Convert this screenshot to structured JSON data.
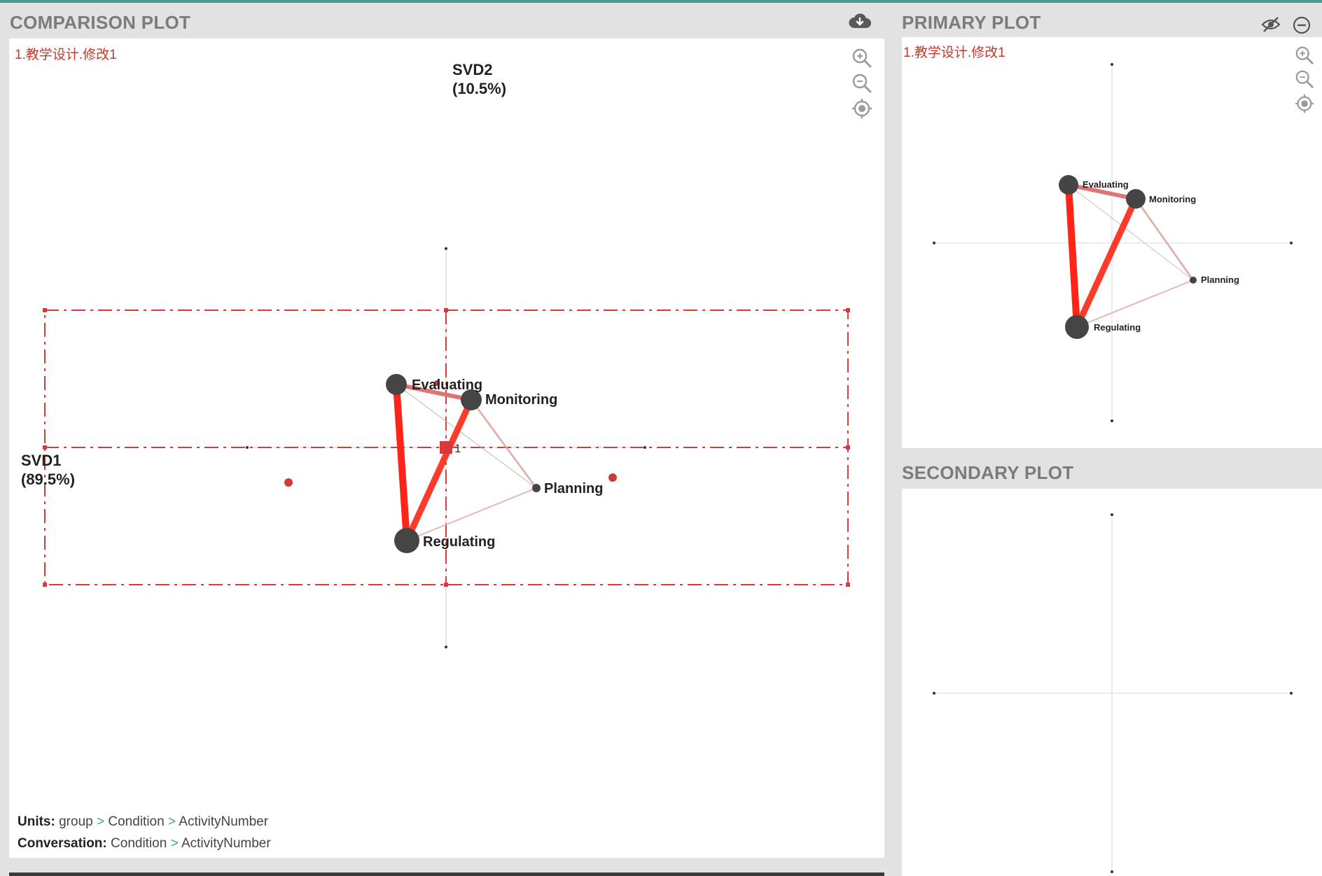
{
  "comparison": {
    "header": "COMPARISON PLOT",
    "plot_name": "1.教学设计.修改1",
    "axis_y_label": "SVD2",
    "axis_y_pct": "(10.5%)",
    "axis_x_label": "SVD1",
    "axis_x_pct": "(89.5%)",
    "centroid_label": "1",
    "nodes": {
      "evaluating": "Evaluating",
      "monitoring": "Monitoring",
      "planning": "Planning",
      "regulating": "Regulating"
    },
    "units_label": "Units:",
    "units_path": [
      "group",
      "Condition",
      "ActivityNumber"
    ],
    "conversation_label": "Conversation:",
    "conversation_path": [
      "Condition",
      "ActivityNumber"
    ],
    "separator": ">"
  },
  "primary": {
    "header": "PRIMARY PLOT",
    "plot_name": "1.教学设计.修改1",
    "nodes": {
      "evaluating": "Evaluating",
      "monitoring": "Monitoring",
      "planning": "Planning",
      "regulating": "Regulating"
    }
  },
  "secondary": {
    "header": "SECONDARY PLOT"
  },
  "icons": {
    "download": "cloud-download-icon",
    "zoom_in": "zoom-in-icon",
    "zoom_out": "zoom-out-icon",
    "recenter": "target-icon",
    "hide": "eye-off-icon",
    "minimize": "minus-circle-icon"
  },
  "colors": {
    "accent": "#4a9a92",
    "edge_strong": "#ff2418",
    "node": "#454545",
    "confidence_box": "#d63a3a",
    "title_red": "#c0392b"
  }
}
